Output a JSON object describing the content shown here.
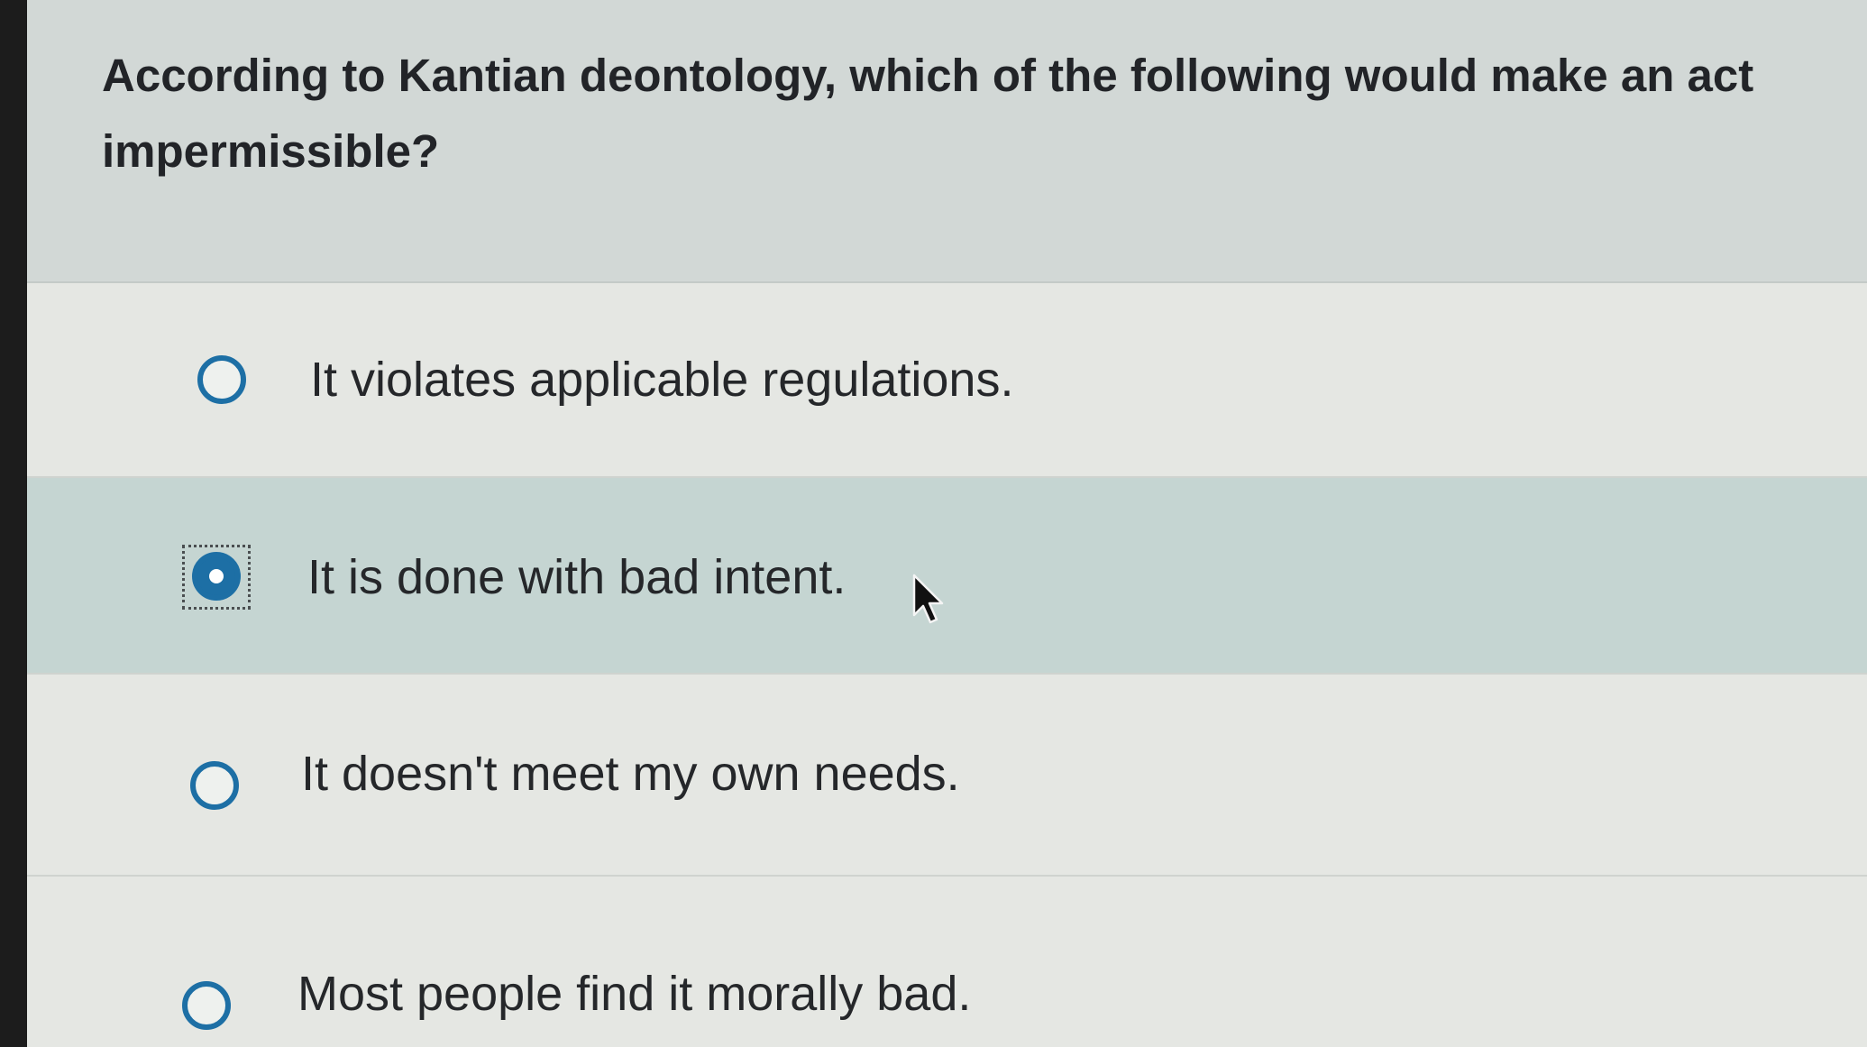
{
  "question": {
    "text": "According to Kantian deontology, which of the following would make an act impermissible?"
  },
  "options": [
    {
      "label": "It violates applicable regulations.",
      "selected": false
    },
    {
      "label": "It is done with bad intent.",
      "selected": true
    },
    {
      "label": "It doesn't meet my own needs.",
      "selected": false
    },
    {
      "label": "Most people find it morally bad.",
      "selected": false
    }
  ],
  "colors": {
    "accent": "#1d6fa5",
    "selected_row": "#c5d5d2",
    "question_bg": "#d2d8d6"
  }
}
